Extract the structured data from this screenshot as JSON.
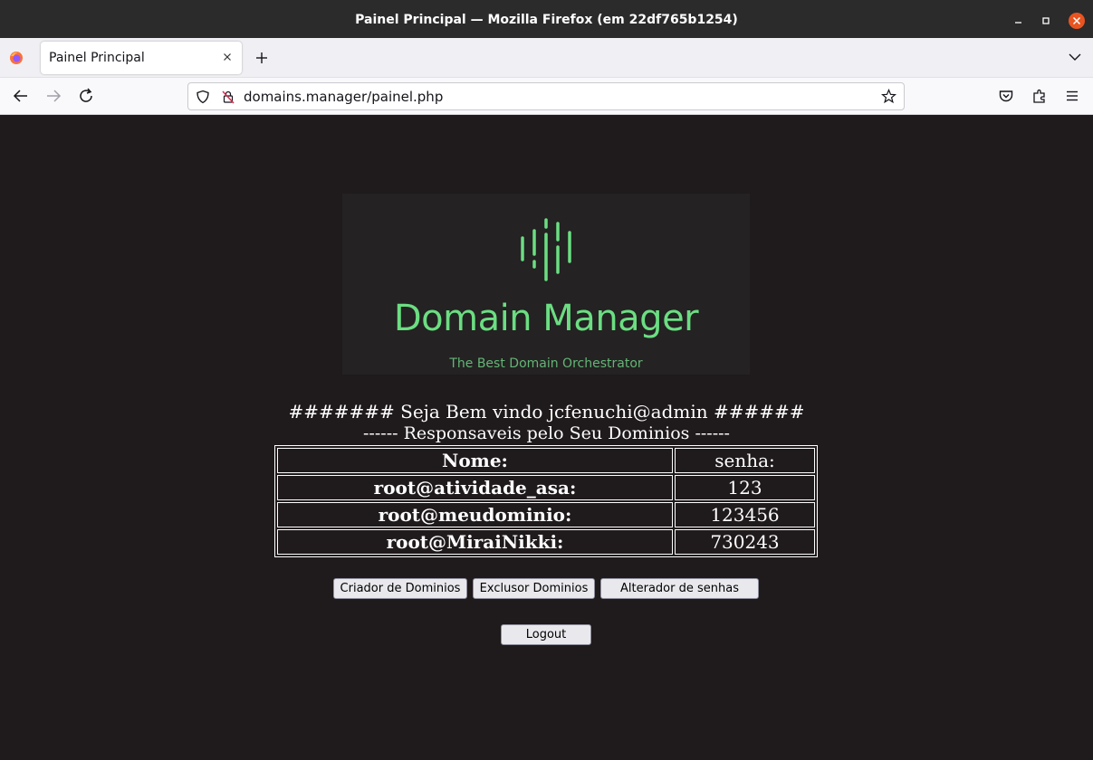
{
  "window": {
    "title": "Painel Principal — Mozilla Firefox (em 22df765b1254)"
  },
  "tabs": [
    {
      "label": "Painel Principal"
    }
  ],
  "navbar": {
    "url": "domains.manager/painel.php"
  },
  "icons": {
    "minimize": "minimize-icon",
    "maximize": "maximize-icon",
    "close": "close-icon",
    "firefox": "firefox-logo-icon",
    "tab_close": "tab-close-icon",
    "new_tab": "plus-icon",
    "tab_list": "chevron-down-icon",
    "back": "arrow-left-icon",
    "forward": "arrow-right-icon",
    "reload": "reload-icon",
    "shield": "shield-icon",
    "insecure_lock": "insecure-lock-icon",
    "bookmark": "star-icon",
    "pocket": "pocket-icon",
    "extensions": "puzzle-icon",
    "menu": "hamburger-menu-icon"
  },
  "page": {
    "logo": {
      "title": "Domain Manager",
      "subtitle": "The Best Domain Orchestrator",
      "accent_color": "#6bde82"
    },
    "welcome": "####### Seja Bem vindo jcfenuchi@admin ######",
    "subheading": "------ Responsaveis pelo Seu Dominios ------",
    "table": {
      "headers": [
        "Nome:",
        "senha:"
      ],
      "rows": [
        [
          "root@atividade_asa:",
          "123"
        ],
        [
          "root@meudominio:",
          "123456"
        ],
        [
          "root@MiraiNikki:",
          "730243"
        ]
      ]
    },
    "buttons": {
      "criar": "Criador de Dominios",
      "excluir": "Exclusor Dominios",
      "alterar": "Alterador de senhas",
      "logout": "Logout"
    },
    "background_color": "#1f1a1b"
  }
}
